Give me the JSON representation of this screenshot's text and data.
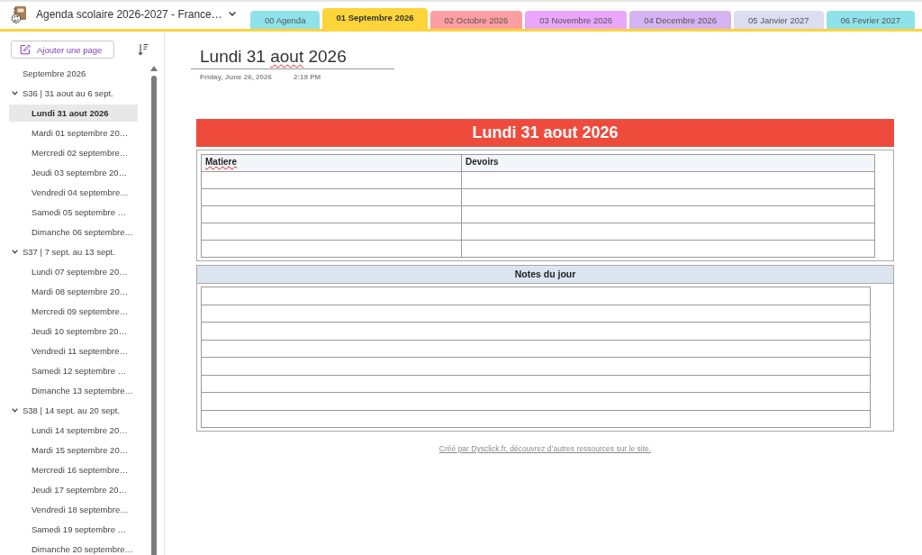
{
  "notebook": {
    "title": "Agenda scolaire 2026-2027 - France…"
  },
  "tabs": [
    {
      "label": "00 Agenda",
      "color": "#8ee3ea",
      "selected": false
    },
    {
      "label": "01 Septembre 2026",
      "color": "#fdd43a",
      "selected": true
    },
    {
      "label": "02 Octobre 2026",
      "color": "#ff9ea2",
      "selected": false
    },
    {
      "label": "03 Novembre 2026",
      "color": "#e9a6fb",
      "selected": false
    },
    {
      "label": "04 Decembre 2026",
      "color": "#d4b4f2",
      "selected": false
    },
    {
      "label": "05 Janvier 2027",
      "color": "#dcdcf2",
      "selected": false
    },
    {
      "label": "06 Fevrier 2027",
      "color": "#8ee3ea",
      "selected": false
    }
  ],
  "sidebar": {
    "add_page_button": "Ajouter une page",
    "pages": [
      {
        "kind": "page",
        "label": "Septembre 2026",
        "selected": false
      },
      {
        "kind": "group",
        "label": "S36 | 31 aout au 6 sept.",
        "selected": false,
        "expanded": true,
        "children": [
          {
            "kind": "page",
            "label": "Lundi 31 aout 2026",
            "selected": true
          },
          {
            "kind": "page",
            "label": "Mardi 01 septembre 20…",
            "selected": false
          },
          {
            "kind": "page",
            "label": "Mercredi 02 septembre…",
            "selected": false
          },
          {
            "kind": "page",
            "label": "Jeudi 03 septembre 20…",
            "selected": false
          },
          {
            "kind": "page",
            "label": "Vendredi 04 septembre…",
            "selected": false
          },
          {
            "kind": "page",
            "label": "Samedi 05 septembre …",
            "selected": false
          },
          {
            "kind": "page",
            "label": "Dimanche 06 septembre…",
            "selected": false
          }
        ]
      },
      {
        "kind": "group",
        "label": "S37 | 7 sept. au 13 sept.",
        "selected": false,
        "expanded": true,
        "children": [
          {
            "kind": "page",
            "label": "Lundi 07 septembre 20…",
            "selected": false
          },
          {
            "kind": "page",
            "label": "Mardi 08 septembre 20…",
            "selected": false
          },
          {
            "kind": "page",
            "label": "Mercredi 09 septembre…",
            "selected": false
          },
          {
            "kind": "page",
            "label": "Jeudi 10 septembre 20…",
            "selected": false
          },
          {
            "kind": "page",
            "label": "Vendredi 11 septembre…",
            "selected": false
          },
          {
            "kind": "page",
            "label": "Samedi 12 septembre …",
            "selected": false
          },
          {
            "kind": "page",
            "label": "Dimanche 13 septembre…",
            "selected": false
          }
        ]
      },
      {
        "kind": "group",
        "label": "S38 | 14 sept. au 20 sept.",
        "selected": false,
        "expanded": true,
        "children": [
          {
            "kind": "page",
            "label": "Lundi 14 septembre 20…",
            "selected": false
          },
          {
            "kind": "page",
            "label": "Mardi 15 septembre 20…",
            "selected": false
          },
          {
            "kind": "page",
            "label": "Mercredi 16 septembre…",
            "selected": false
          },
          {
            "kind": "page",
            "label": "Jeudi 17 septembre 20…",
            "selected": false
          },
          {
            "kind": "page",
            "label": "Vendredi 18 septembre…",
            "selected": false
          },
          {
            "kind": "page",
            "label": "Samedi 19 septembre …",
            "selected": false
          },
          {
            "kind": "page",
            "label": "Dimanche 20 septembre…",
            "selected": false
          }
        ]
      }
    ]
  },
  "page": {
    "title": [
      {
        "text": "Lundi 31 ",
        "misspelled": false
      },
      {
        "text": "aout",
        "misspelled": true
      },
      {
        "text": " 2026",
        "misspelled": false
      }
    ],
    "date": "Friday, June 26, 2026",
    "time": "2:19 PM",
    "banner": "Lundi 31 aout 2026",
    "homework_table": {
      "columns": [
        {
          "label": "Matiere",
          "misspelled": true
        },
        {
          "label": "Devoirs",
          "misspelled": false
        }
      ],
      "rows": [
        {
          "kind": "blank"
        },
        {
          "kind": "blank"
        },
        {
          "kind": "blank"
        },
        {
          "kind": "blank"
        },
        {
          "kind": "blank"
        }
      ]
    },
    "notes": {
      "heading": "Notes du jour",
      "rows": [
        {
          "kind": "blank"
        },
        {
          "kind": "blank"
        },
        {
          "kind": "blank"
        },
        {
          "kind": "blank"
        },
        {
          "kind": "blank"
        },
        {
          "kind": "blank"
        },
        {
          "kind": "blank"
        },
        {
          "kind": "blank"
        }
      ]
    },
    "footer_link": "Créé par Dysclick.fr, découvrez d’autres ressources sur le site."
  }
}
